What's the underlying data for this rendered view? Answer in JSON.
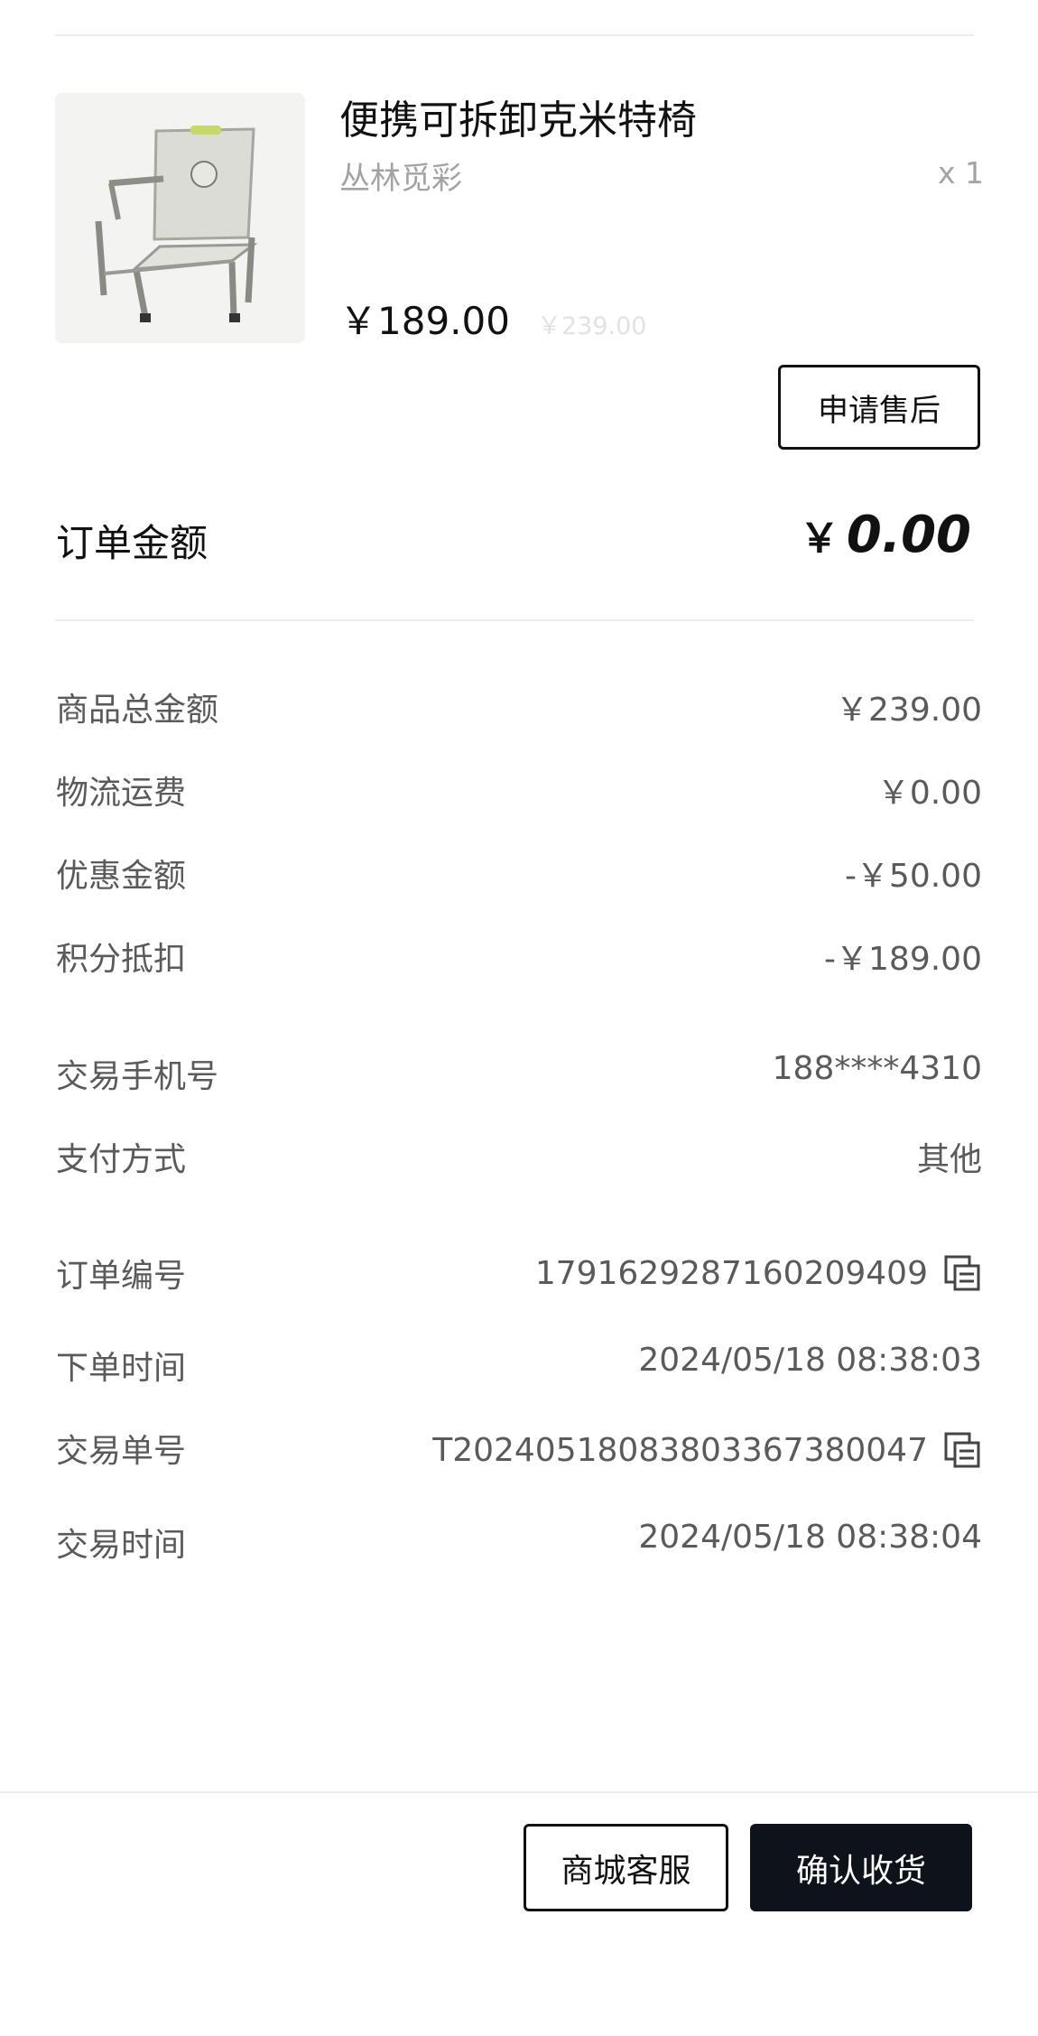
{
  "product": {
    "title": "便携可拆卸克米特椅",
    "brand": "丛林觅彩",
    "quantity": "x 1",
    "price": "￥189.00",
    "original_price": "￥239.00",
    "image_icon": "camping-chair-image"
  },
  "actions": {
    "after_sale": "申请售后",
    "customer_service": "商城客服",
    "confirm_receipt": "确认收货"
  },
  "order_total": {
    "label": "订单金额",
    "currency": "￥",
    "amount": "0.00"
  },
  "cost_rows": [
    {
      "label": "商品总金额",
      "value": "￥239.00"
    },
    {
      "label": "物流运费",
      "value": "￥0.00"
    },
    {
      "label": "优惠金额",
      "value": "-￥50.00"
    },
    {
      "label": "积分抵扣",
      "value": "-￥189.00"
    }
  ],
  "payment_rows": [
    {
      "label": "交易手机号",
      "value": "188****4310"
    },
    {
      "label": "支付方式",
      "value": "其他"
    }
  ],
  "info_rows": [
    {
      "label": "订单编号",
      "value": "1791629287160209409",
      "copy_icon": "copy-icon"
    },
    {
      "label": "下单时间",
      "value": "2024/05/18 08:38:03"
    },
    {
      "label": "交易单号",
      "value": "T2024051808380336738004​7",
      "copy_icon": "copy-icon"
    },
    {
      "label": "交易时间",
      "value": "2024/05/18 08:38:04"
    }
  ],
  "colors": {
    "text_primary": "#111111",
    "text_secondary": "#5a5a5a",
    "text_muted": "#a3a3a3",
    "confirm_button_bg": "#0e121a",
    "divider": "#ececec"
  }
}
